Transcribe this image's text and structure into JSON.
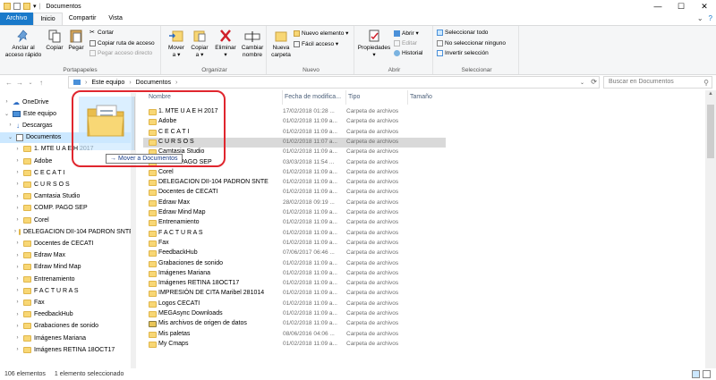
{
  "window": {
    "title": "Documentos",
    "controls": {
      "minimize": "—",
      "maximize": "☐",
      "close": "✕"
    }
  },
  "tabs": [
    {
      "label": "Archivo"
    },
    {
      "label": "Inicio"
    },
    {
      "label": "Compartir"
    },
    {
      "label": "Vista"
    }
  ],
  "ribbon": {
    "portapapeles": {
      "label": "Portapapeles",
      "anclar": [
        "Anclar al",
        "acceso rápido"
      ],
      "copiar": "Copiar",
      "pegar": "Pegar",
      "cortar": "Cortar",
      "copiar_ruta": "Copiar ruta de acceso",
      "pegar_acceso": "Pegar acceso directo"
    },
    "organizar": {
      "label": "Organizar",
      "mover": [
        "Mover",
        "a ▾"
      ],
      "copiar": [
        "Copiar",
        "a ▾"
      ],
      "eliminar": [
        "Eliminar",
        "▾"
      ],
      "cambiar": [
        "Cambiar",
        "nombre"
      ]
    },
    "nuevo": {
      "label": "Nuevo",
      "nueva_carpeta": [
        "Nueva",
        "carpeta"
      ],
      "nuevo_elemento": "Nuevo elemento ▾",
      "facil_acceso": "Fácil acceso ▾"
    },
    "abrir": {
      "label": "Abrir",
      "propiedades": "Propiedades ▾",
      "abrir": "Abrir ▾",
      "editar": "Editar",
      "historial": "Historial"
    },
    "seleccionar": {
      "label": "Seleccionar",
      "todo": "Seleccionar todo",
      "ninguno": "No seleccionar ninguno",
      "invertir": "Invertir selección"
    }
  },
  "address": {
    "crumbs": [
      "Este equipo",
      "Documentos"
    ],
    "search_placeholder": "Buscar en Documentos"
  },
  "nav": [
    {
      "label": "OneDrive",
      "level": 0,
      "icon": "cloud",
      "chev": "›"
    },
    {
      "label": "Este equipo",
      "level": 0,
      "icon": "pc",
      "chev": "⌄"
    },
    {
      "label": "Descargas",
      "level": 1,
      "icon": "download",
      "chev": "›"
    },
    {
      "label": "Documentos",
      "level": 1,
      "icon": "docs",
      "chev": "⌄",
      "selected": true
    },
    {
      "label": "1. MTE U A E H  2017",
      "level": 2,
      "icon": "folder",
      "chev": "›"
    },
    {
      "label": "Adobe",
      "level": 2,
      "icon": "folder",
      "chev": "›"
    },
    {
      "label": "C E C A T I",
      "level": 2,
      "icon": "folder",
      "chev": "›"
    },
    {
      "label": "C U R S O S",
      "level": 2,
      "icon": "folder",
      "chev": "›"
    },
    {
      "label": "Camtasia Studio",
      "level": 2,
      "icon": "folder",
      "chev": "›"
    },
    {
      "label": "COMP. PAGO SEP",
      "level": 2,
      "icon": "folder",
      "chev": "›"
    },
    {
      "label": "Corel",
      "level": 2,
      "icon": "folder",
      "chev": "›"
    },
    {
      "label": "DELEGACION DII-104 PADRON SNTE",
      "level": 2,
      "icon": "folder",
      "chev": "›"
    },
    {
      "label": "Docentes de CECATI",
      "level": 2,
      "icon": "folder",
      "chev": "›"
    },
    {
      "label": "Edraw Max",
      "level": 2,
      "icon": "folder",
      "chev": "›"
    },
    {
      "label": "Edraw Mind Map",
      "level": 2,
      "icon": "folder",
      "chev": "›"
    },
    {
      "label": "Entrenamiento",
      "level": 2,
      "icon": "folder",
      "chev": "›"
    },
    {
      "label": "F A C T U R A S",
      "level": 2,
      "icon": "folder",
      "chev": "›"
    },
    {
      "label": "Fax",
      "level": 2,
      "icon": "folder",
      "chev": "›"
    },
    {
      "label": "FeedbackHub",
      "level": 2,
      "icon": "folder",
      "chev": "›"
    },
    {
      "label": "Grabaciones de sonido",
      "level": 2,
      "icon": "folder",
      "chev": "›"
    },
    {
      "label": "Imágenes Mariana",
      "level": 2,
      "icon": "folder",
      "chev": "›"
    },
    {
      "label": "Imágenes RETINA 18OCT17",
      "level": 2,
      "icon": "folder",
      "chev": "›"
    }
  ],
  "columns": [
    "Nombre",
    "Fecha de modifica...",
    "Tipo",
    "Tamaño"
  ],
  "files": [
    {
      "name": "1. MTE U A E H  2017",
      "date": "17/02/2018 01:28 ...",
      "type": "Carpeta de archivos"
    },
    {
      "name": "Adobe",
      "date": "01/02/2018 11:09 a...",
      "type": "Carpeta de archivos"
    },
    {
      "name": "C E C A T I",
      "date": "01/02/2018 11:09 a...",
      "type": "Carpeta de archivos"
    },
    {
      "name": "C U R S O S",
      "date": "01/02/2018 11:07 a...",
      "type": "Carpeta de archivos",
      "selected": true
    },
    {
      "name": "Camtasia Studio",
      "date": "01/02/2018 11:09 a...",
      "type": "Carpeta de archivos"
    },
    {
      "name": "COMP. PAGO SEP",
      "date": "03/03/2018 11:54 ...",
      "type": "Carpeta de archivos"
    },
    {
      "name": "Corel",
      "date": "01/02/2018 11:09 a...",
      "type": "Carpeta de archivos"
    },
    {
      "name": "DELEGACION DII-104 PADRON SNTE",
      "date": "01/02/2018 11:09 a...",
      "type": "Carpeta de archivos"
    },
    {
      "name": "Docentes de CECATI",
      "date": "01/02/2018 11:09 a...",
      "type": "Carpeta de archivos"
    },
    {
      "name": "Edraw Max",
      "date": "28/02/2018 09:19 ...",
      "type": "Carpeta de archivos"
    },
    {
      "name": "Edraw Mind Map",
      "date": "01/02/2018 11:09 a...",
      "type": "Carpeta de archivos"
    },
    {
      "name": "Entrenamiento",
      "date": "01/02/2018 11:09 a...",
      "type": "Carpeta de archivos"
    },
    {
      "name": "F A C T U R A S",
      "date": "01/02/2018 11:09 a...",
      "type": "Carpeta de archivos"
    },
    {
      "name": "Fax",
      "date": "01/02/2018 11:09 a...",
      "type": "Carpeta de archivos"
    },
    {
      "name": "FeedbackHub",
      "date": "07/06/2017 06:46 ...",
      "type": "Carpeta de archivos"
    },
    {
      "name": "Grabaciones de sonido",
      "date": "01/02/2018 11:09 a...",
      "type": "Carpeta de archivos"
    },
    {
      "name": "Imágenes Mariana",
      "date": "01/02/2018 11:09 a...",
      "type": "Carpeta de archivos"
    },
    {
      "name": "Imágenes RETINA 18OCT17",
      "date": "01/02/2018 11:09 a...",
      "type": "Carpeta de archivos"
    },
    {
      "name": "IMPRESIÓN DE CITA Maribel 281014",
      "date": "01/02/2018 11:09 a...",
      "type": "Carpeta de archivos"
    },
    {
      "name": "Logos CECATI",
      "date": "01/02/2018 11:09 a...",
      "type": "Carpeta de archivos"
    },
    {
      "name": "MEGAsync Downloads",
      "date": "01/02/2018 11:09 a...",
      "type": "Carpeta de archivos"
    },
    {
      "name": "Mis archivos de origen de datos",
      "date": "01/02/2018 11:09 a...",
      "type": "Carpeta de archivos",
      "special": true
    },
    {
      "name": "Mis paletas",
      "date": "08/06/2016 04:06 ...",
      "type": "Carpeta de archivos"
    },
    {
      "name": "My Cmaps",
      "date": "01/02/2018 11:09 a...",
      "type": "Carpeta de archivos"
    }
  ],
  "drag": {
    "tooltip": "Mover a Documentos",
    "highlight_color": "#e0262e"
  },
  "status": {
    "count": "106 elementos",
    "selection": "1 elemento seleccionado"
  },
  "colors": {
    "file_tab": "#1979ca",
    "selection": "#cce8ff",
    "folder": "#f8d775"
  }
}
